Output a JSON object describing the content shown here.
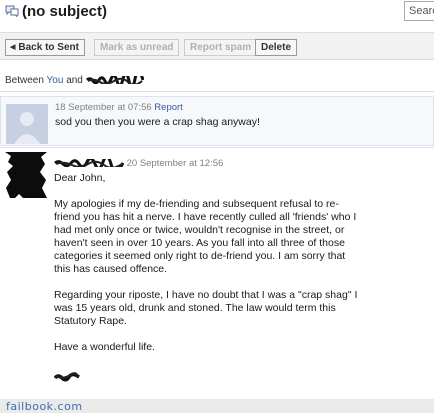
{
  "window": {
    "title": "(no subject)"
  },
  "search": {
    "placeholder": "Search"
  },
  "toolbar": {
    "back_label": "Back to Sent",
    "mark_unread_label": "Mark as unread",
    "report_spam_label": "Report spam",
    "delete_label": "Delete"
  },
  "participants": {
    "prefix": "Between",
    "you": "You",
    "conjunction": "and"
  },
  "messages": [
    {
      "timestamp": "18 September at 07:56",
      "report_label": "Report",
      "body": "sod you then you were a crap shag anyway!"
    },
    {
      "timestamp": "20 September at 12:56",
      "greeting": "Dear John,",
      "para1_l1": "My apologies if my de-friending and subsequent refusal to re-",
      "para1_l2": "friend you has hit a nerve. I have recently culled all 'friends' who I",
      "para1_l3": "had met only once or twice, wouldn't recognise in the street, or",
      "para1_l4": "haven't seen in over 10 years. As you fall into all three of those",
      "para1_l5": "categories it seemed only right to de-friend you. I am sorry that",
      "para1_l6": "this has caused offence.",
      "para2_l1": "Regarding your riposte, I have no doubt that I was a \"crap shag\" I",
      "para2_l2": "was 15 years old, drunk and stoned. The law would term this",
      "para2_l3": "Statutory Rape.",
      "closing": "Have a wonderful life."
    }
  ],
  "footer": {
    "watermark": "failbook.com"
  },
  "icons": {
    "title_icon": "speech-bubbles-icon",
    "back_icon": "triangle-left-icon"
  },
  "colors": {
    "link": "#3b5998",
    "watermark": "#3a6fb0"
  }
}
